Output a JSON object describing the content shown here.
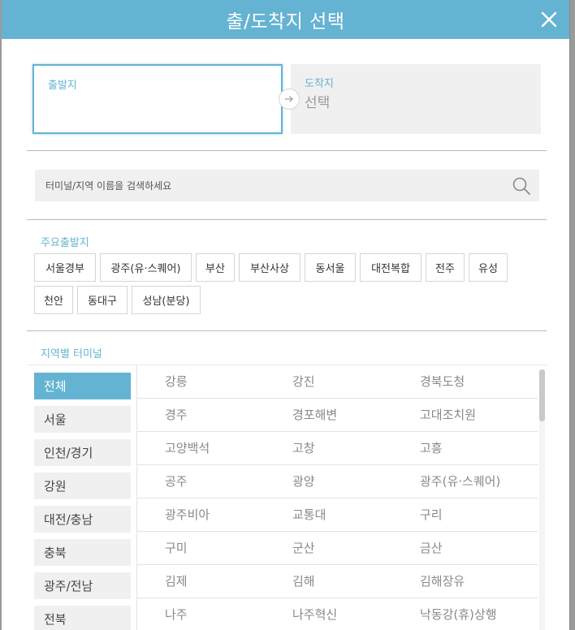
{
  "header": {
    "title": "출/도착지 선택"
  },
  "route": {
    "departure": {
      "label": "출발지",
      "value": ""
    },
    "arrival": {
      "label": "도착지",
      "value": "선택"
    }
  },
  "search": {
    "placeholder": "터미널/지역 이름을 검색하세요",
    "value": ""
  },
  "major_departures": {
    "title": "주요출발지",
    "items": [
      "서울경부",
      "광주(유·스퀘어)",
      "부산",
      "부산사상",
      "동서울",
      "대전복합",
      "전주",
      "유성",
      "천안",
      "동대구",
      "성남(분당)"
    ]
  },
  "regions": {
    "title": "지역별 터미널",
    "items": [
      "전체",
      "서울",
      "인천/경기",
      "강원",
      "대전/충남",
      "충북",
      "광주/전남",
      "전북"
    ],
    "active_index": 0
  },
  "terminals": [
    [
      "강릉",
      "강진",
      "경북도청"
    ],
    [
      "경주",
      "경포해변",
      "고대조치원"
    ],
    [
      "고양백석",
      "고창",
      "고흥"
    ],
    [
      "공주",
      "광양",
      "광주(유·스퀘어)"
    ],
    [
      "광주비아",
      "교통대",
      "구리"
    ],
    [
      "구미",
      "군산",
      "금산"
    ],
    [
      "김제",
      "김해",
      "김해장유"
    ],
    [
      "나주",
      "나주혁신",
      "낙동강(휴)상행"
    ]
  ],
  "colors": {
    "accent": "#64b3d2",
    "panel_bg": "#f0f0f0",
    "text_muted": "#888888"
  },
  "icons": {
    "close": "close-icon",
    "arrow": "arrow-right-icon",
    "search": "search-icon"
  }
}
